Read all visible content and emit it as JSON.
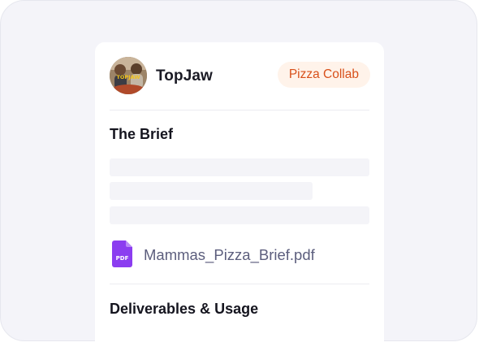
{
  "card": {
    "creator_name": "TopJaw",
    "avatar_caption": "TOPJAW",
    "campaign_tag": "Pizza Collab",
    "brief_title": "The Brief",
    "attachment": {
      "icon_label": "PDF",
      "file_name": "Mammas_Pizza_Brief.pdf"
    },
    "deliverables_title": "Deliverables & Usage"
  },
  "colors": {
    "tag_text": "#d8501a",
    "tag_background": "#fff3ea",
    "pdf_icon": "#8b3df0",
    "file_name_text": "#5c5e7d"
  }
}
